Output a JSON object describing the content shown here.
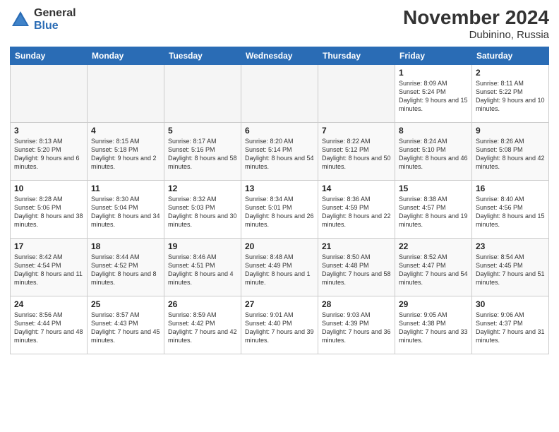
{
  "header": {
    "logo_general": "General",
    "logo_blue": "Blue",
    "month_title": "November 2024",
    "location": "Dubinino, Russia"
  },
  "weekdays": [
    "Sunday",
    "Monday",
    "Tuesday",
    "Wednesday",
    "Thursday",
    "Friday",
    "Saturday"
  ],
  "weeks": [
    [
      {
        "day": "",
        "info": ""
      },
      {
        "day": "",
        "info": ""
      },
      {
        "day": "",
        "info": ""
      },
      {
        "day": "",
        "info": ""
      },
      {
        "day": "",
        "info": ""
      },
      {
        "day": "1",
        "info": "Sunrise: 8:09 AM\nSunset: 5:24 PM\nDaylight: 9 hours and 15 minutes."
      },
      {
        "day": "2",
        "info": "Sunrise: 8:11 AM\nSunset: 5:22 PM\nDaylight: 9 hours and 10 minutes."
      }
    ],
    [
      {
        "day": "3",
        "info": "Sunrise: 8:13 AM\nSunset: 5:20 PM\nDaylight: 9 hours and 6 minutes."
      },
      {
        "day": "4",
        "info": "Sunrise: 8:15 AM\nSunset: 5:18 PM\nDaylight: 9 hours and 2 minutes."
      },
      {
        "day": "5",
        "info": "Sunrise: 8:17 AM\nSunset: 5:16 PM\nDaylight: 8 hours and 58 minutes."
      },
      {
        "day": "6",
        "info": "Sunrise: 8:20 AM\nSunset: 5:14 PM\nDaylight: 8 hours and 54 minutes."
      },
      {
        "day": "7",
        "info": "Sunrise: 8:22 AM\nSunset: 5:12 PM\nDaylight: 8 hours and 50 minutes."
      },
      {
        "day": "8",
        "info": "Sunrise: 8:24 AM\nSunset: 5:10 PM\nDaylight: 8 hours and 46 minutes."
      },
      {
        "day": "9",
        "info": "Sunrise: 8:26 AM\nSunset: 5:08 PM\nDaylight: 8 hours and 42 minutes."
      }
    ],
    [
      {
        "day": "10",
        "info": "Sunrise: 8:28 AM\nSunset: 5:06 PM\nDaylight: 8 hours and 38 minutes."
      },
      {
        "day": "11",
        "info": "Sunrise: 8:30 AM\nSunset: 5:04 PM\nDaylight: 8 hours and 34 minutes."
      },
      {
        "day": "12",
        "info": "Sunrise: 8:32 AM\nSunset: 5:03 PM\nDaylight: 8 hours and 30 minutes."
      },
      {
        "day": "13",
        "info": "Sunrise: 8:34 AM\nSunset: 5:01 PM\nDaylight: 8 hours and 26 minutes."
      },
      {
        "day": "14",
        "info": "Sunrise: 8:36 AM\nSunset: 4:59 PM\nDaylight: 8 hours and 22 minutes."
      },
      {
        "day": "15",
        "info": "Sunrise: 8:38 AM\nSunset: 4:57 PM\nDaylight: 8 hours and 19 minutes."
      },
      {
        "day": "16",
        "info": "Sunrise: 8:40 AM\nSunset: 4:56 PM\nDaylight: 8 hours and 15 minutes."
      }
    ],
    [
      {
        "day": "17",
        "info": "Sunrise: 8:42 AM\nSunset: 4:54 PM\nDaylight: 8 hours and 11 minutes."
      },
      {
        "day": "18",
        "info": "Sunrise: 8:44 AM\nSunset: 4:52 PM\nDaylight: 8 hours and 8 minutes."
      },
      {
        "day": "19",
        "info": "Sunrise: 8:46 AM\nSunset: 4:51 PM\nDaylight: 8 hours and 4 minutes."
      },
      {
        "day": "20",
        "info": "Sunrise: 8:48 AM\nSunset: 4:49 PM\nDaylight: 8 hours and 1 minute."
      },
      {
        "day": "21",
        "info": "Sunrise: 8:50 AM\nSunset: 4:48 PM\nDaylight: 7 hours and 58 minutes."
      },
      {
        "day": "22",
        "info": "Sunrise: 8:52 AM\nSunset: 4:47 PM\nDaylight: 7 hours and 54 minutes."
      },
      {
        "day": "23",
        "info": "Sunrise: 8:54 AM\nSunset: 4:45 PM\nDaylight: 7 hours and 51 minutes."
      }
    ],
    [
      {
        "day": "24",
        "info": "Sunrise: 8:56 AM\nSunset: 4:44 PM\nDaylight: 7 hours and 48 minutes."
      },
      {
        "day": "25",
        "info": "Sunrise: 8:57 AM\nSunset: 4:43 PM\nDaylight: 7 hours and 45 minutes."
      },
      {
        "day": "26",
        "info": "Sunrise: 8:59 AM\nSunset: 4:42 PM\nDaylight: 7 hours and 42 minutes."
      },
      {
        "day": "27",
        "info": "Sunrise: 9:01 AM\nSunset: 4:40 PM\nDaylight: 7 hours and 39 minutes."
      },
      {
        "day": "28",
        "info": "Sunrise: 9:03 AM\nSunset: 4:39 PM\nDaylight: 7 hours and 36 minutes."
      },
      {
        "day": "29",
        "info": "Sunrise: 9:05 AM\nSunset: 4:38 PM\nDaylight: 7 hours and 33 minutes."
      },
      {
        "day": "30",
        "info": "Sunrise: 9:06 AM\nSunset: 4:37 PM\nDaylight: 7 hours and 31 minutes."
      }
    ]
  ]
}
